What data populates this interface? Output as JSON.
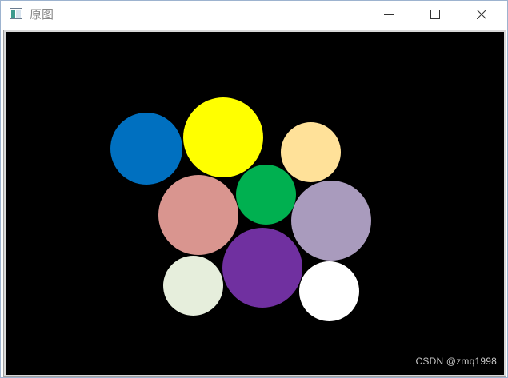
{
  "window": {
    "title": "原图"
  },
  "controls": {
    "minimize": "minimize",
    "maximize": "maximize",
    "close": "close"
  },
  "canvas": {
    "background": "#000000",
    "circles": [
      {
        "name": "circle-blue",
        "color": "#0070c0"
      },
      {
        "name": "circle-yellow",
        "color": "#ffff00"
      },
      {
        "name": "circle-light-orange",
        "color": "#ffe199"
      },
      {
        "name": "circle-rose",
        "color": "#d9958f"
      },
      {
        "name": "circle-green",
        "color": "#00b050"
      },
      {
        "name": "circle-lavender",
        "color": "#a99bbd"
      },
      {
        "name": "circle-pale-green",
        "color": "#e6eedc"
      },
      {
        "name": "circle-purple",
        "color": "#7030a0"
      },
      {
        "name": "circle-white",
        "color": "#ffffff"
      }
    ]
  },
  "watermark": "CSDN @zmq1998"
}
